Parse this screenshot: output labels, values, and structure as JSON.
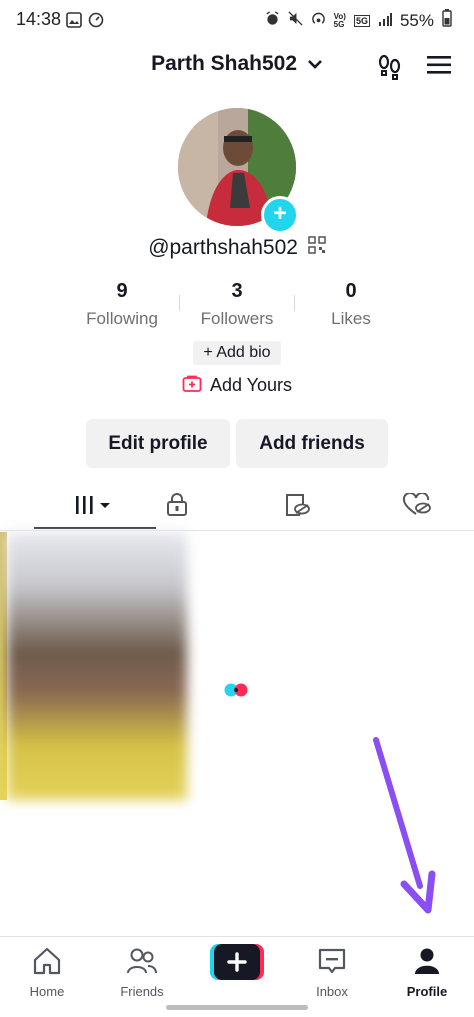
{
  "status_bar": {
    "time": "14:38",
    "battery": "55%"
  },
  "header": {
    "username": "Parth Shah502"
  },
  "profile": {
    "handle": "@parthshah502",
    "stats": [
      {
        "value": "9",
        "label": "Following"
      },
      {
        "value": "3",
        "label": "Followers"
      },
      {
        "value": "0",
        "label": "Likes"
      }
    ],
    "add_bio_label": "+ Add bio",
    "add_yours_label": "Add Yours",
    "edit_profile_label": "Edit profile",
    "add_friends_label": "Add friends"
  },
  "tabs": {
    "icons": [
      "grid-filter-icon",
      "lock-icon",
      "hidden-video-icon",
      "liked-hidden-icon"
    ],
    "active_index": 0
  },
  "colors": {
    "accent_cyan": "#20d5ec",
    "accent_red": "#fe2c55",
    "arrow_purple": "#8b4ef2"
  },
  "bottom_nav": {
    "home": "Home",
    "friends": "Friends",
    "inbox": "Inbox",
    "profile": "Profile"
  }
}
